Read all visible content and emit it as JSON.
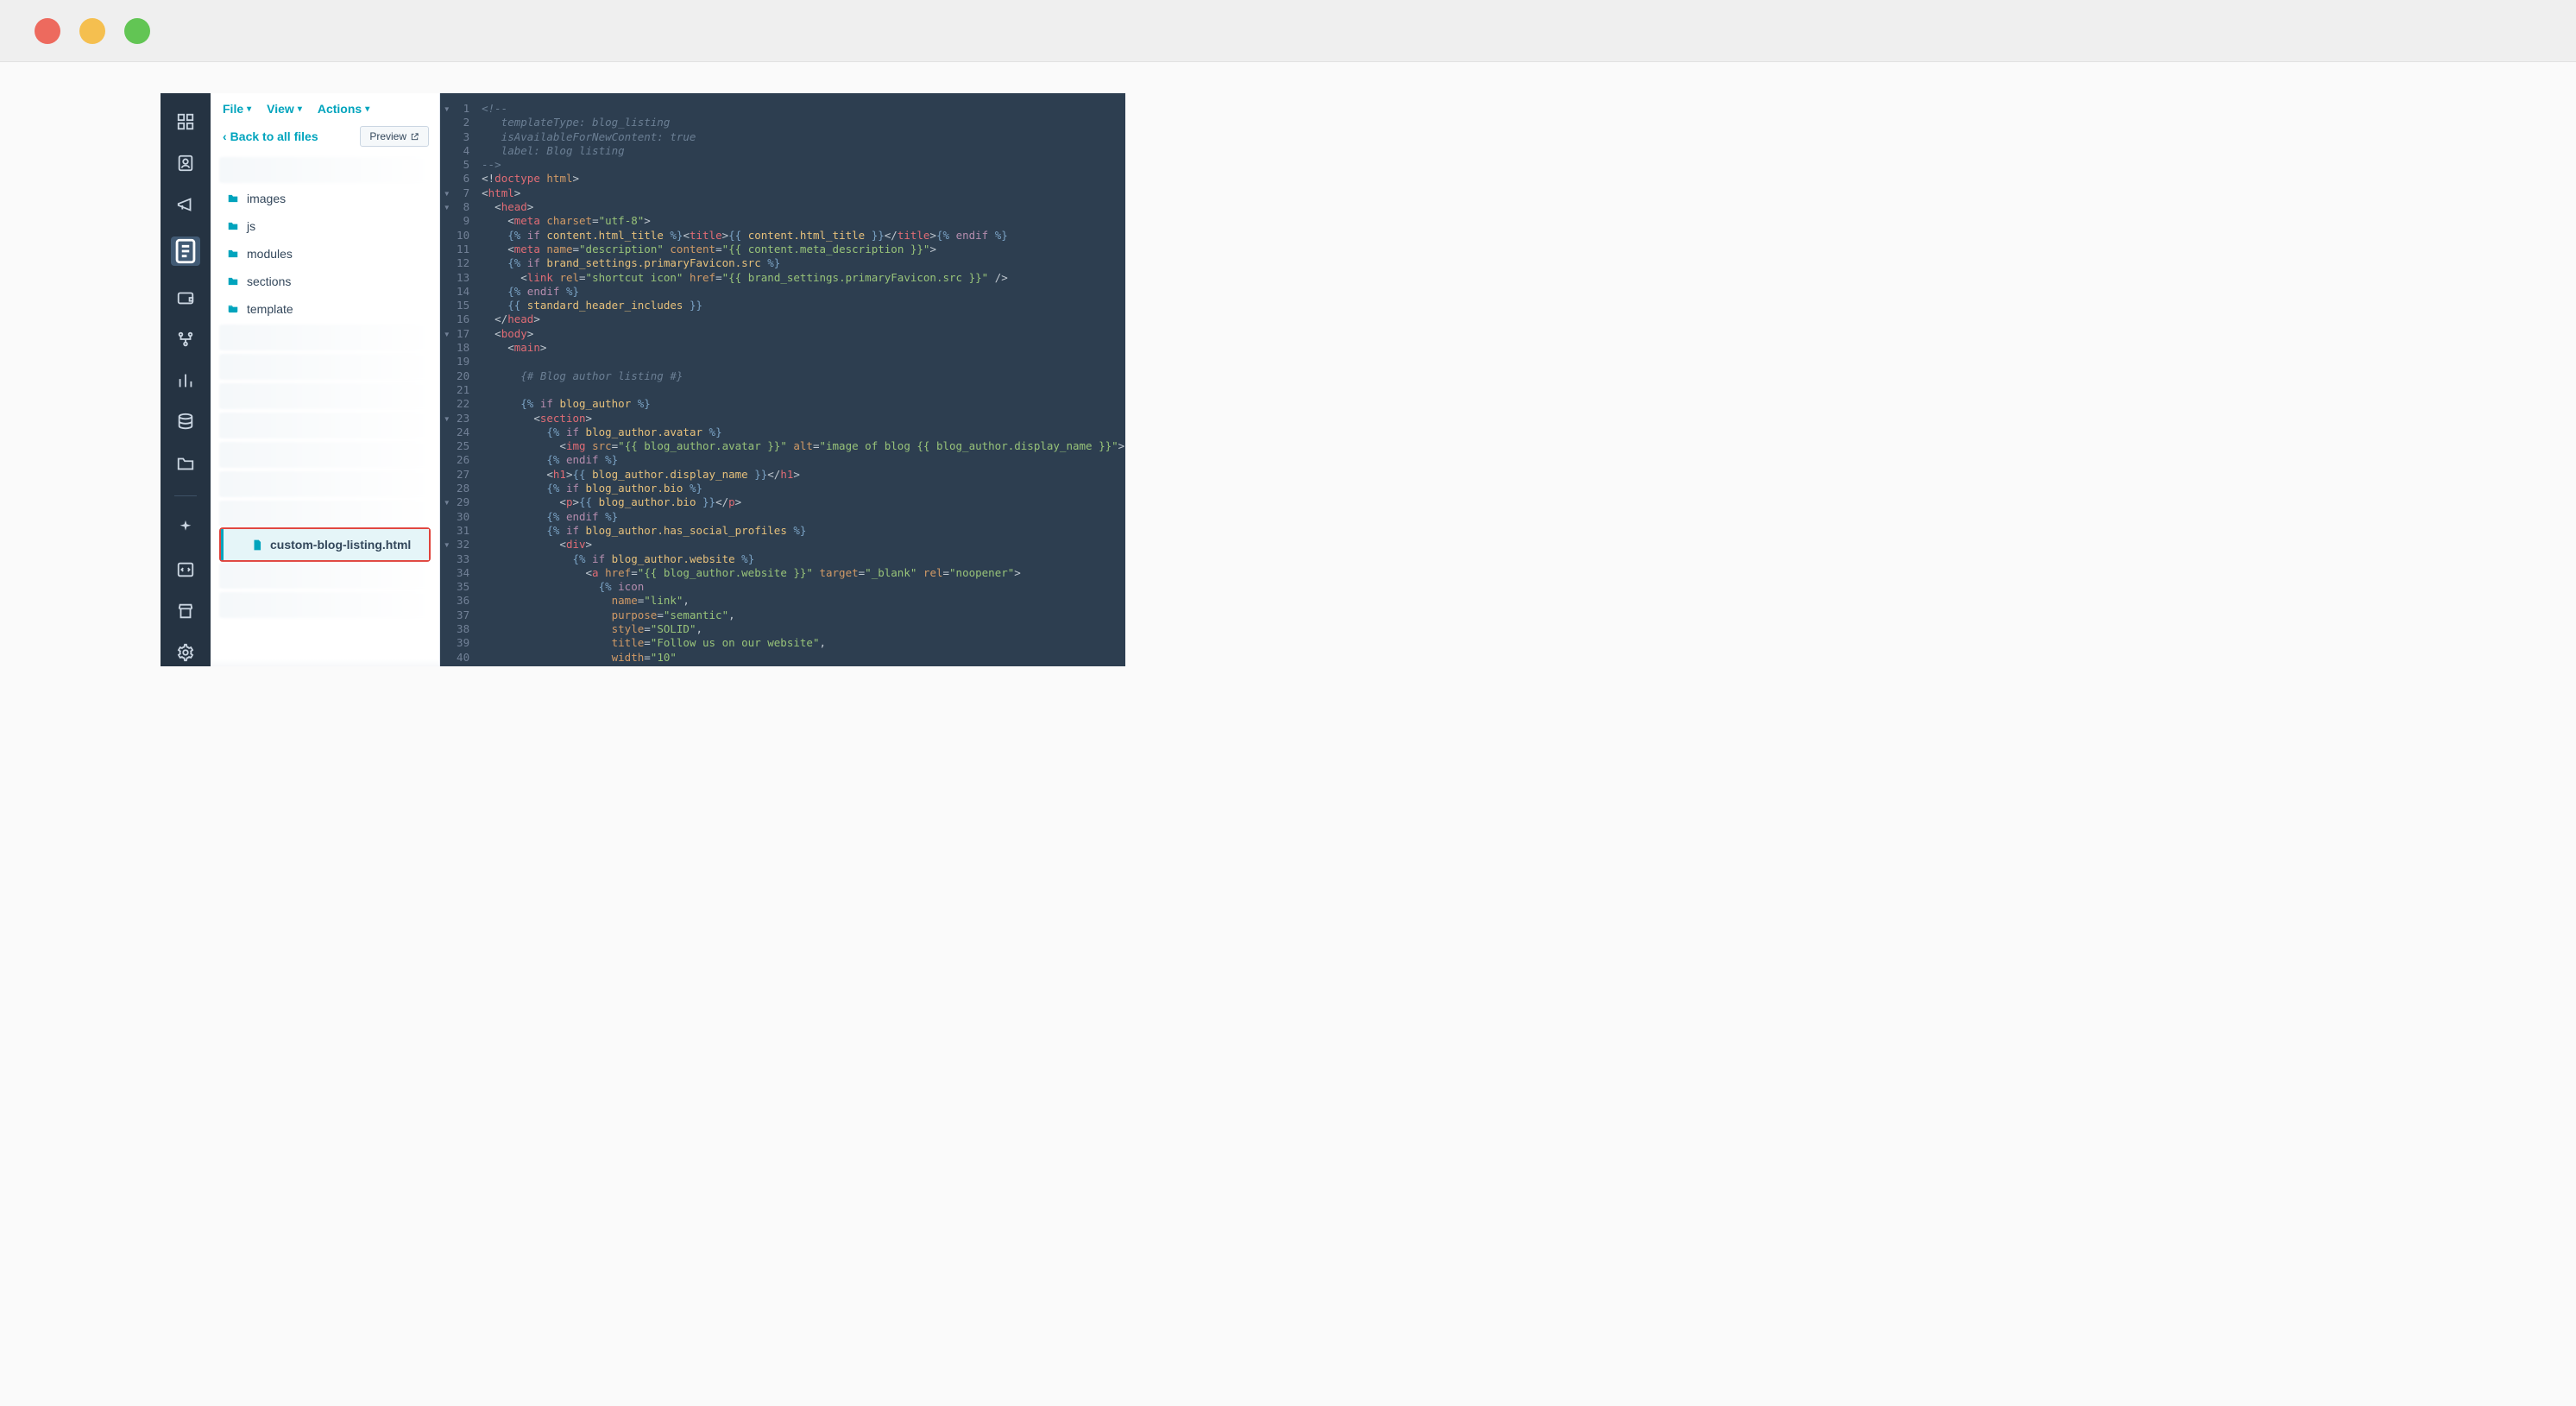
{
  "menubar": {
    "file": "File",
    "view": "View",
    "actions": "Actions"
  },
  "panel": {
    "back": "Back to all files",
    "preview": "Preview"
  },
  "folders": [
    {
      "name": "images"
    },
    {
      "name": "js"
    },
    {
      "name": "modules"
    },
    {
      "name": "sections"
    },
    {
      "name": "template"
    }
  ],
  "active_file": "custom-blog-listing.html",
  "code_lines": [
    {
      "n": 1,
      "fold": "▾",
      "tokens": [
        [
          "c",
          "<!--"
        ]
      ]
    },
    {
      "n": 2,
      "fold": "",
      "tokens": [
        [
          "c",
          "   templateType: blog_listing"
        ]
      ]
    },
    {
      "n": 3,
      "fold": "",
      "tokens": [
        [
          "c",
          "   isAvailableForNewContent: true"
        ]
      ]
    },
    {
      "n": 4,
      "fold": "",
      "tokens": [
        [
          "c",
          "   label: Blog listing"
        ]
      ]
    },
    {
      "n": 5,
      "fold": "",
      "tokens": [
        [
          "c",
          "-->"
        ]
      ]
    },
    {
      "n": 6,
      "fold": "",
      "tokens": [
        [
          "pun",
          "<!"
        ],
        [
          "tag",
          "doctype "
        ],
        [
          "at",
          "html"
        ],
        [
          "pun",
          ">"
        ]
      ]
    },
    {
      "n": 7,
      "fold": "▾",
      "tokens": [
        [
          "pun",
          "<"
        ],
        [
          "tag",
          "html"
        ],
        [
          "pun",
          ">"
        ]
      ]
    },
    {
      "n": 8,
      "fold": "▾",
      "tokens": [
        [
          "pun",
          "  <"
        ],
        [
          "tag",
          "head"
        ],
        [
          "pun",
          ">"
        ]
      ]
    },
    {
      "n": 9,
      "fold": "",
      "tokens": [
        [
          "pun",
          "    <"
        ],
        [
          "tag",
          "meta "
        ],
        [
          "at",
          "charset"
        ],
        [
          "pun",
          "="
        ],
        [
          "st",
          "\"utf-8\""
        ],
        [
          "pun",
          ">"
        ]
      ]
    },
    {
      "n": 10,
      "fold": "",
      "tokens": [
        [
          "tmpl",
          "    {% "
        ],
        [
          "kw",
          "if"
        ],
        [
          "tmpl",
          " "
        ],
        [
          "var",
          "content.html_title"
        ],
        [
          "tmpl",
          " %}"
        ],
        [
          "pun",
          "<"
        ],
        [
          "tag",
          "title"
        ],
        [
          "pun",
          ">"
        ],
        [
          "tmpl",
          "{{ "
        ],
        [
          "var",
          "content.html_title"
        ],
        [
          "tmpl",
          " }}"
        ],
        [
          "pun",
          "</"
        ],
        [
          "tag",
          "title"
        ],
        [
          "pun",
          ">"
        ],
        [
          "tmpl",
          "{% "
        ],
        [
          "kw",
          "endif"
        ],
        [
          "tmpl",
          " %}"
        ]
      ]
    },
    {
      "n": 11,
      "fold": "",
      "tokens": [
        [
          "pun",
          "    <"
        ],
        [
          "tag",
          "meta "
        ],
        [
          "at",
          "name"
        ],
        [
          "pun",
          "="
        ],
        [
          "st",
          "\"description\""
        ],
        [
          "at",
          " content"
        ],
        [
          "pun",
          "="
        ],
        [
          "st",
          "\"{{ content.meta_description }}\""
        ],
        [
          "pun",
          ">"
        ]
      ]
    },
    {
      "n": 12,
      "fold": "",
      "tokens": [
        [
          "tmpl",
          "    {% "
        ],
        [
          "kw",
          "if"
        ],
        [
          "tmpl",
          " "
        ],
        [
          "var",
          "brand_settings.primaryFavicon.src"
        ],
        [
          "tmpl",
          " %}"
        ]
      ]
    },
    {
      "n": 13,
      "fold": "",
      "tokens": [
        [
          "pun",
          "      <"
        ],
        [
          "tag",
          "link "
        ],
        [
          "at",
          "rel"
        ],
        [
          "pun",
          "="
        ],
        [
          "st",
          "\"shortcut icon\""
        ],
        [
          "at",
          " href"
        ],
        [
          "pun",
          "="
        ],
        [
          "st",
          "\"{{ brand_settings.primaryFavicon.src }}\""
        ],
        [
          "pun",
          " />"
        ]
      ]
    },
    {
      "n": 14,
      "fold": "",
      "tokens": [
        [
          "tmpl",
          "    {% "
        ],
        [
          "kw",
          "endif"
        ],
        [
          "tmpl",
          " %}"
        ]
      ]
    },
    {
      "n": 15,
      "fold": "",
      "tokens": [
        [
          "tmpl",
          "    {{ "
        ],
        [
          "var",
          "standard_header_includes"
        ],
        [
          "tmpl",
          " }}"
        ]
      ]
    },
    {
      "n": 16,
      "fold": "",
      "tokens": [
        [
          "pun",
          "  </"
        ],
        [
          "tag",
          "head"
        ],
        [
          "pun",
          ">"
        ]
      ]
    },
    {
      "n": 17,
      "fold": "▾",
      "tokens": [
        [
          "pun",
          "  <"
        ],
        [
          "tag",
          "body"
        ],
        [
          "pun",
          ">"
        ]
      ]
    },
    {
      "n": 18,
      "fold": "",
      "tokens": [
        [
          "pun",
          "    <"
        ],
        [
          "tag",
          "main"
        ],
        [
          "pun",
          ">"
        ]
      ]
    },
    {
      "n": 19,
      "fold": "",
      "tokens": [
        [
          "",
          ""
        ]
      ]
    },
    {
      "n": 20,
      "fold": "",
      "tokens": [
        [
          "c",
          "      {# Blog author listing #}"
        ]
      ]
    },
    {
      "n": 21,
      "fold": "",
      "tokens": [
        [
          "",
          ""
        ]
      ]
    },
    {
      "n": 22,
      "fold": "",
      "tokens": [
        [
          "tmpl",
          "      {% "
        ],
        [
          "kw",
          "if"
        ],
        [
          "tmpl",
          " "
        ],
        [
          "var",
          "blog_author"
        ],
        [
          "tmpl",
          " %}"
        ]
      ]
    },
    {
      "n": 23,
      "fold": "▾",
      "tokens": [
        [
          "pun",
          "        <"
        ],
        [
          "tag",
          "section"
        ],
        [
          "pun",
          ">"
        ]
      ]
    },
    {
      "n": 24,
      "fold": "",
      "tokens": [
        [
          "tmpl",
          "          {% "
        ],
        [
          "kw",
          "if"
        ],
        [
          "tmpl",
          " "
        ],
        [
          "var",
          "blog_author.avatar"
        ],
        [
          "tmpl",
          " %}"
        ]
      ]
    },
    {
      "n": 25,
      "fold": "",
      "tokens": [
        [
          "pun",
          "            <"
        ],
        [
          "tag",
          "img "
        ],
        [
          "at",
          "src"
        ],
        [
          "pun",
          "="
        ],
        [
          "st",
          "\"{{ blog_author.avatar }}\""
        ],
        [
          "at",
          " alt"
        ],
        [
          "pun",
          "="
        ],
        [
          "st",
          "\"image of blog {{ blog_author.display_name }}\""
        ],
        [
          "pun",
          ">"
        ]
      ]
    },
    {
      "n": 26,
      "fold": "",
      "tokens": [
        [
          "tmpl",
          "          {% "
        ],
        [
          "kw",
          "endif"
        ],
        [
          "tmpl",
          " %}"
        ]
      ]
    },
    {
      "n": 27,
      "fold": "",
      "tokens": [
        [
          "pun",
          "          <"
        ],
        [
          "tag",
          "h1"
        ],
        [
          "pun",
          ">"
        ],
        [
          "tmpl",
          "{{ "
        ],
        [
          "var",
          "blog_author.display_name"
        ],
        [
          "tmpl",
          " }}"
        ],
        [
          "pun",
          "</"
        ],
        [
          "tag",
          "h1"
        ],
        [
          "pun",
          ">"
        ]
      ]
    },
    {
      "n": 28,
      "fold": "",
      "tokens": [
        [
          "tmpl",
          "          {% "
        ],
        [
          "kw",
          "if"
        ],
        [
          "tmpl",
          " "
        ],
        [
          "var",
          "blog_author.bio"
        ],
        [
          "tmpl",
          " %}"
        ]
      ]
    },
    {
      "n": 29,
      "fold": "▾",
      "tokens": [
        [
          "pun",
          "            <"
        ],
        [
          "tag",
          "p"
        ],
        [
          "pun",
          ">"
        ],
        [
          "tmpl",
          "{{ "
        ],
        [
          "var",
          "blog_author.bio"
        ],
        [
          "tmpl",
          " }}"
        ],
        [
          "pun",
          "</"
        ],
        [
          "tag",
          "p"
        ],
        [
          "pun",
          ">"
        ]
      ]
    },
    {
      "n": 30,
      "fold": "",
      "tokens": [
        [
          "tmpl",
          "          {% "
        ],
        [
          "kw",
          "endif"
        ],
        [
          "tmpl",
          " %}"
        ]
      ]
    },
    {
      "n": 31,
      "fold": "",
      "tokens": [
        [
          "tmpl",
          "          {% "
        ],
        [
          "kw",
          "if"
        ],
        [
          "tmpl",
          " "
        ],
        [
          "var",
          "blog_author.has_social_profiles"
        ],
        [
          "tmpl",
          " %}"
        ]
      ]
    },
    {
      "n": 32,
      "fold": "▾",
      "tokens": [
        [
          "pun",
          "            <"
        ],
        [
          "tag",
          "div"
        ],
        [
          "pun",
          ">"
        ]
      ]
    },
    {
      "n": 33,
      "fold": "",
      "tokens": [
        [
          "tmpl",
          "              {% "
        ],
        [
          "kw",
          "if"
        ],
        [
          "tmpl",
          " "
        ],
        [
          "var",
          "blog_author.website"
        ],
        [
          "tmpl",
          " %}"
        ]
      ]
    },
    {
      "n": 34,
      "fold": "",
      "tokens": [
        [
          "pun",
          "                <"
        ],
        [
          "tag",
          "a "
        ],
        [
          "at",
          "href"
        ],
        [
          "pun",
          "="
        ],
        [
          "st",
          "\"{{ blog_author.website }}\""
        ],
        [
          "at",
          " target"
        ],
        [
          "pun",
          "="
        ],
        [
          "st",
          "\"_blank\""
        ],
        [
          "at",
          " rel"
        ],
        [
          "pun",
          "="
        ],
        [
          "st",
          "\"noopener\""
        ],
        [
          "pun",
          ">"
        ]
      ]
    },
    {
      "n": 35,
      "fold": "",
      "tokens": [
        [
          "tmpl",
          "                  {% "
        ],
        [
          "kw",
          "icon"
        ]
      ]
    },
    {
      "n": 36,
      "fold": "",
      "tokens": [
        [
          "at",
          "                    name"
        ],
        [
          "pun",
          "="
        ],
        [
          "st",
          "\"link\""
        ],
        [
          "pun",
          ","
        ]
      ]
    },
    {
      "n": 37,
      "fold": "",
      "tokens": [
        [
          "at",
          "                    purpose"
        ],
        [
          "pun",
          "="
        ],
        [
          "st",
          "\"semantic\""
        ],
        [
          "pun",
          ","
        ]
      ]
    },
    {
      "n": 38,
      "fold": "",
      "tokens": [
        [
          "at",
          "                    style"
        ],
        [
          "pun",
          "="
        ],
        [
          "st",
          "\"SOLID\""
        ],
        [
          "pun",
          ","
        ]
      ]
    },
    {
      "n": 39,
      "fold": "",
      "tokens": [
        [
          "at",
          "                    title"
        ],
        [
          "pun",
          "="
        ],
        [
          "st",
          "\"Follow us on our website\""
        ],
        [
          "pun",
          ","
        ]
      ]
    },
    {
      "n": 40,
      "fold": "",
      "tokens": [
        [
          "at",
          "                    width"
        ],
        [
          "pun",
          "="
        ],
        [
          "st",
          "\"10\""
        ]
      ]
    }
  ]
}
